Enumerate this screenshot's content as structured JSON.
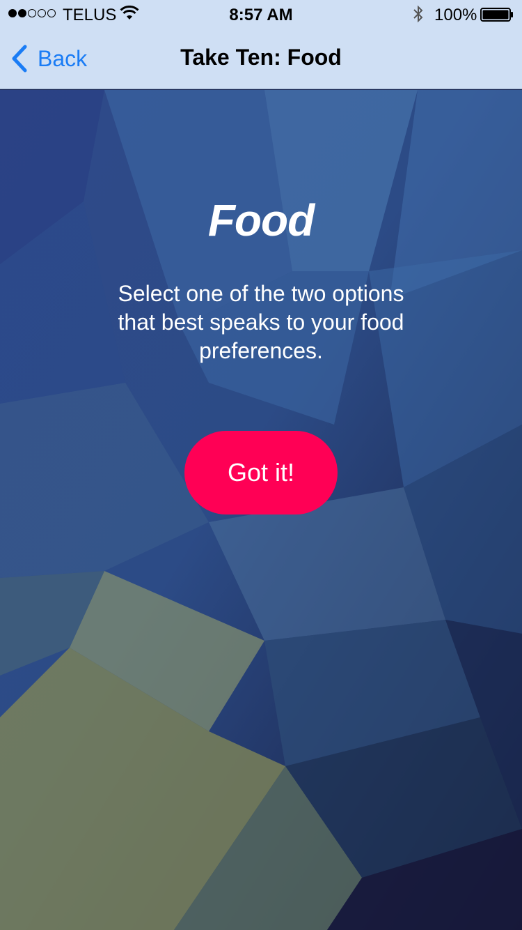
{
  "status_bar": {
    "carrier": "TELUS",
    "time": "8:57 AM",
    "battery_text": "100%",
    "signal_bars_filled": 2,
    "signal_bars_total": 5,
    "battery_level": 1.0
  },
  "nav": {
    "back_label": "Back",
    "title": "Take Ten: Food",
    "tint_color": "#1a7cf5",
    "background_color": "#cfdff4"
  },
  "main": {
    "heading": "Food",
    "description": "Select one of the two options that best speaks to your food preferences.",
    "button_label": "Got it!",
    "button_color": "#ff0055"
  },
  "icons": [
    "signal-icon",
    "wifi-icon",
    "bluetooth-icon",
    "battery-icon",
    "chevron-left-icon"
  ]
}
